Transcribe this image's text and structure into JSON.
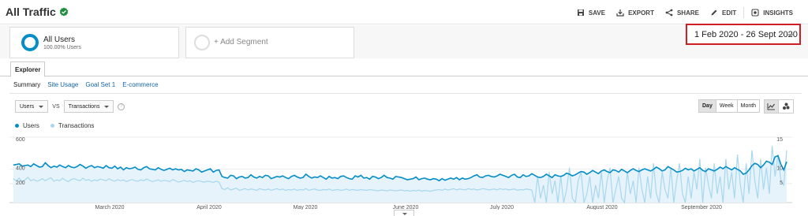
{
  "header": {
    "title": "All Traffic",
    "actions": [
      {
        "label": "SAVE",
        "icon": "save-icon"
      },
      {
        "label": "EXPORT",
        "icon": "export-icon"
      },
      {
        "label": "SHARE",
        "icon": "share-icon"
      },
      {
        "label": "EDIT",
        "icon": "edit-icon"
      },
      {
        "label": "INSIGHTS",
        "icon": "insights-icon"
      }
    ]
  },
  "segments": {
    "active": {
      "name": "All Users",
      "sub": "100.00% Users"
    },
    "add_label": "+ Add Segment"
  },
  "daterange": "1 Feb 2020 - 26 Sept 2020",
  "tabs": {
    "explorer": "Explorer"
  },
  "subtabs": [
    "Summary",
    "Site Usage",
    "Goal Set 1",
    "E-commerce"
  ],
  "controls": {
    "metric1": "Users",
    "vs": "VS",
    "metric2": "Transactions",
    "help": "?",
    "periods": [
      "Day",
      "Week",
      "Month"
    ],
    "active_period": "Day"
  },
  "colors": {
    "users": "#058dc7",
    "transactions": "#a8d7ee",
    "area": "#e6f3fa",
    "highlight": "#cf1f25"
  },
  "chart_data": {
    "type": "line",
    "legend": [
      "Users",
      "Transactions"
    ],
    "left_axis_ticks": [
      "600",
      "400",
      "200"
    ],
    "right_axis_ticks": [
      "15",
      "10",
      "5"
    ],
    "x_ticks": [
      "March 2020",
      "April 2020",
      "May 2020",
      "June 2020",
      "July 2020",
      "August 2020",
      "September 2020"
    ],
    "ylim_left": [
      0,
      600
    ],
    "ylim_right": [
      0,
      15
    ],
    "series": [
      {
        "name": "Users",
        "axis": "left",
        "values": [
          345,
          350,
          355,
          335,
          340,
          345,
          330,
          355,
          340,
          325,
          330,
          365,
          340,
          320,
          335,
          325,
          345,
          330,
          320,
          340,
          325,
          320,
          330,
          350,
          335,
          315,
          330,
          340,
          320,
          330,
          325,
          315,
          340,
          320,
          315,
          335,
          310,
          325,
          300,
          320,
          310,
          315,
          325,
          305,
          300,
          320,
          330,
          310,
          305,
          300,
          320,
          305,
          295,
          305,
          315,
          300,
          310,
          300,
          305,
          285,
          300,
          295,
          290,
          310,
          300,
          280,
          290,
          300,
          310,
          280,
          295,
          300,
          240,
          230,
          225,
          250,
          245,
          220,
          235,
          240,
          225,
          230,
          255,
          235,
          225,
          240,
          230,
          250,
          245,
          220,
          230,
          240,
          235,
          245,
          230,
          220,
          240,
          250,
          235,
          225,
          230,
          260,
          240,
          225,
          235,
          230,
          245,
          230,
          215,
          240,
          225,
          230,
          220,
          240,
          245,
          230,
          220,
          215,
          245,
          235,
          250,
          225,
          230,
          215,
          240,
          235,
          220,
          230,
          250,
          230,
          225,
          215,
          240,
          235,
          230,
          220,
          210,
          215,
          220,
          235,
          210,
          220,
          225,
          215,
          210,
          220,
          215,
          200,
          220,
          205,
          215,
          225,
          215,
          230,
          210,
          225,
          215,
          220,
          230,
          245,
          255,
          235,
          230,
          245,
          250,
          240,
          235,
          245,
          260,
          250,
          240,
          230,
          250,
          260,
          235,
          230,
          255,
          240,
          245,
          265,
          250,
          235,
          230,
          240,
          260,
          245,
          230,
          255,
          245,
          240,
          250,
          270,
          260,
          245,
          255,
          270,
          285,
          280,
          260,
          275,
          295,
          280,
          265,
          290,
          300,
          285,
          275,
          300,
          295,
          280,
          305,
          290,
          275,
          295,
          310,
          295,
          285,
          300,
          310,
          300,
          290,
          305,
          325,
          310,
          290,
          300,
          330,
          315,
          300,
          280,
          285,
          295,
          315,
          300,
          310,
          290,
          305,
          320,
          295,
          285,
          310,
          300,
          290,
          305,
          325,
          310,
          330,
          315,
          300,
          320,
          305,
          290,
          260,
          270,
          300,
          340,
          360,
          350,
          320,
          345,
          380,
          370,
          350,
          420,
          430,
          350,
          300,
          375
        ]
      },
      {
        "name": "Transactions",
        "axis": "right",
        "values": [
          5.5,
          5.0,
          5.6,
          4.8,
          5.2,
          5.8,
          5.0,
          5.3,
          4.9,
          5.1,
          5.5,
          5.0,
          5.4,
          5.7,
          4.9,
          5.2,
          5.0,
          5.6,
          5.1,
          4.8,
          5.3,
          5.5,
          5.2,
          5.0,
          5.6,
          5.1,
          5.3,
          4.9,
          5.2,
          5.0,
          5.4,
          5.2,
          5.0,
          5.5,
          5.1,
          4.9,
          5.3,
          5.0,
          5.2,
          4.8,
          5.1,
          5.3,
          5.0,
          4.9,
          5.2,
          5.0,
          5.4,
          5.1,
          4.8,
          5.0,
          5.2,
          4.9,
          5.1,
          5.0,
          4.8,
          5.3,
          5.0,
          4.7,
          4.9,
          5.1,
          4.8,
          5.0,
          4.6,
          4.9,
          5.0,
          4.8,
          4.7,
          4.9,
          4.8,
          4.6,
          4.9,
          4.7,
          3.2,
          3.0,
          3.4,
          2.9,
          3.1,
          3.3,
          2.8,
          3.0,
          3.2,
          2.9,
          3.1,
          3.0,
          2.8,
          3.2,
          3.0,
          2.9,
          3.1,
          2.8,
          3.0,
          3.2,
          2.9,
          3.1,
          2.8,
          3.0,
          2.9,
          3.1,
          2.8,
          3.0,
          2.9,
          3.2,
          2.8,
          3.0,
          3.1,
          2.9,
          2.8,
          3.0,
          2.9,
          3.1,
          2.8,
          2.9,
          3.0,
          2.8,
          2.9,
          3.1,
          2.8,
          3.0,
          2.9,
          2.8,
          3.0,
          2.9,
          2.8,
          3.0,
          2.9,
          2.8,
          2.7,
          2.9,
          2.8,
          2.7,
          2.9,
          2.8,
          2.7,
          2.8,
          2.9,
          2.7,
          2.8,
          2.6,
          2.8,
          2.7,
          2.9,
          2.6,
          2.8,
          2.7,
          2.6,
          2.8,
          2.9,
          3.0,
          2.8,
          3.1,
          2.9,
          3.0,
          3.2,
          2.9,
          3.1,
          3.0,
          2.9,
          3.2,
          3.0,
          3.1,
          2.9,
          3.0,
          3.2,
          3.1,
          2.9,
          3.0,
          3.1,
          2.9,
          3.2,
          3.0,
          3.1,
          2.9,
          3.0,
          3.1,
          2.8,
          3.0,
          2.9,
          3.1,
          3.0,
          2.9,
          0,
          6,
          1,
          4,
          0,
          7,
          2,
          5,
          0,
          6,
          0,
          3,
          8,
          1,
          0,
          5,
          7,
          0,
          2,
          6,
          0,
          4,
          1,
          7,
          0,
          5,
          8,
          0,
          3,
          6,
          1,
          0,
          7,
          2,
          5,
          0,
          8,
          3,
          0,
          6,
          1,
          9,
          2,
          0,
          7,
          3,
          1,
          8,
          0,
          5,
          9,
          2,
          0,
          6,
          1,
          7,
          3,
          10,
          0,
          8,
          4,
          1,
          9,
          2,
          6,
          0,
          10,
          3,
          7,
          1,
          11,
          4,
          0,
          9,
          2,
          12,
          5,
          1,
          10,
          3,
          8,
          2,
          13,
          6,
          11,
          5,
          4,
          12
        ]
      }
    ]
  }
}
